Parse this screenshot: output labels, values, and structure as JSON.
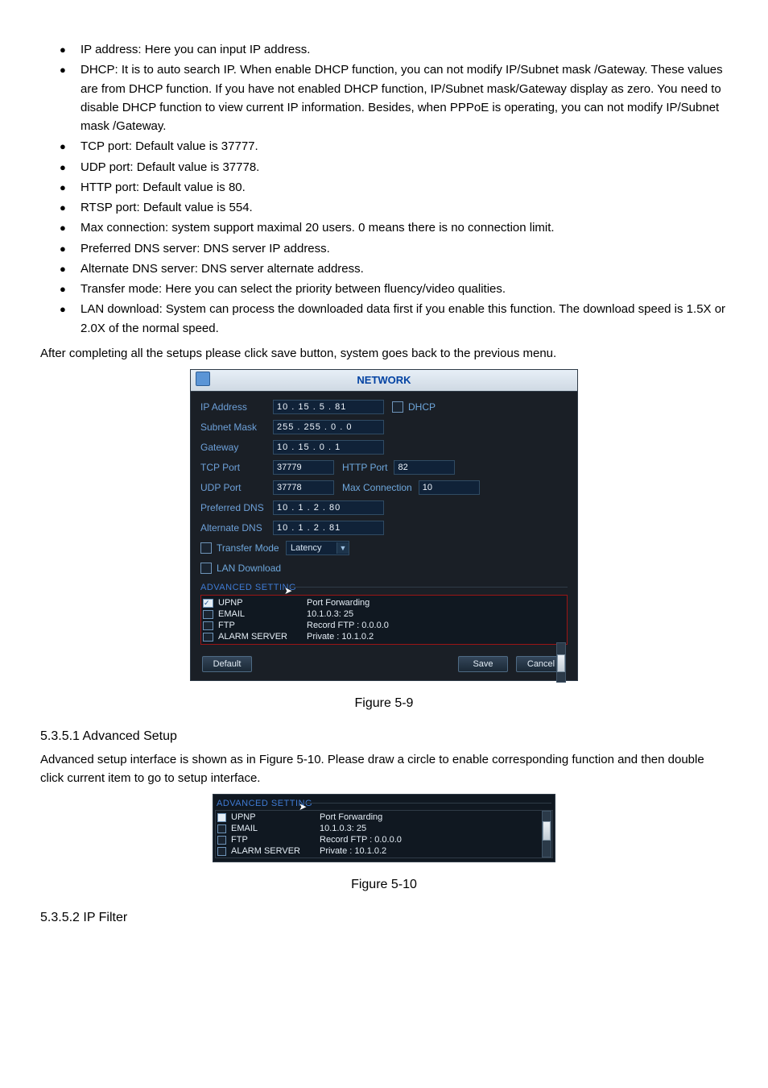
{
  "bullets": {
    "ip_address": "IP address: Here you can input IP address.",
    "dhcp": "DHCP: It is to auto search IP. When enable DHCP function, you can not modify IP/Subnet mask /Gateway. These values are from DHCP function. If you have not enabled DHCP function, IP/Subnet mask/Gateway display as zero. You need to disable DHCP function to view current IP information.  Besides, when PPPoE is operating, you can not modify IP/Subnet mask /Gateway.",
    "tcp_port": "TCP port: Default value is 37777.",
    "udp_port": "UDP port: Default value is 37778.",
    "http_port": "HTTP port: Default value is 80.",
    "rtsp_port": "RTSP port: Default value is 554.",
    "max_conn": "Max connection: system support maximal 20 users. 0 means there is no connection limit.",
    "pref_dns": "Preferred DNS server: DNS server IP address.",
    "alt_dns": "Alternate DNS server: DNS server alternate address.",
    "transfer": "Transfer mode: Here you can select the priority between fluency/video qualities.",
    "lan_dl": "LAN download: System can process the downloaded data first if you enable this function. The download speed is 1.5X or 2.0X of the normal speed."
  },
  "after_text": "After completing all the setups please click save button, system goes back to the previous menu.",
  "network": {
    "title": "NETWORK",
    "labels": {
      "ip": "IP Address",
      "subnet": "Subnet Mask",
      "gateway": "Gateway",
      "tcp": "TCP Port",
      "udp": "UDP Port",
      "pref_dns": "Preferred DNS",
      "alt_dns": "Alternate DNS",
      "http": "HTTP Port",
      "maxconn": "Max Connection",
      "transfer": "Transfer Mode",
      "lan": "LAN Download"
    },
    "values": {
      "ip": "10   .  15   .   5   .  81",
      "subnet": "255  . 255  .   0   .   0",
      "gateway": "10   .  15   .   0   .   1",
      "tcp": "37779",
      "udp": "37778",
      "http": "82",
      "maxconn": "10",
      "pref_dns": "10   .   1    .   2   .  80",
      "alt_dns": "10   .   1    .   2   .  81",
      "transfer_sel": "Latency"
    },
    "dhcp_label": "DHCP",
    "adv_header": "ADVANCED SETTING",
    "adv_rows": [
      {
        "name": "UPNP",
        "val": "Port Forwarding",
        "checked": true
      },
      {
        "name": "EMAIL",
        "val": "10.1.0.3: 25",
        "checked": false
      },
      {
        "name": "FTP",
        "val": "Record FTP : 0.0.0.0",
        "checked": false
      },
      {
        "name": "ALARM SERVER",
        "val": "Private : 10.1.0.2",
        "checked": false
      }
    ],
    "buttons": {
      "default": "Default",
      "save": "Save",
      "cancel": "Cancel"
    }
  },
  "fig59": "Figure 5-9",
  "sec535_1_heading": "5.3.5.1  Advanced Setup",
  "sec535_1_body": "Advanced setup interface is shown as in Figure 5-10. Please draw a circle to enable corresponding function and then double click current item to go to setup interface.",
  "fig510": "Figure 5-10",
  "fig510_data": {
    "header": "ADVANCED SETTING",
    "rows": [
      {
        "name": "UPNP",
        "val": "Port Forwarding",
        "checked": true
      },
      {
        "name": "EMAIL",
        "val": "10.1.0.3: 25",
        "checked": false
      },
      {
        "name": "FTP",
        "val": "Record FTP : 0.0.0.0",
        "checked": false
      },
      {
        "name": "ALARM SERVER",
        "val": "Private : 10.1.0.2",
        "checked": false
      }
    ]
  },
  "sec535_2_heading": "5.3.5.2  IP Filter"
}
